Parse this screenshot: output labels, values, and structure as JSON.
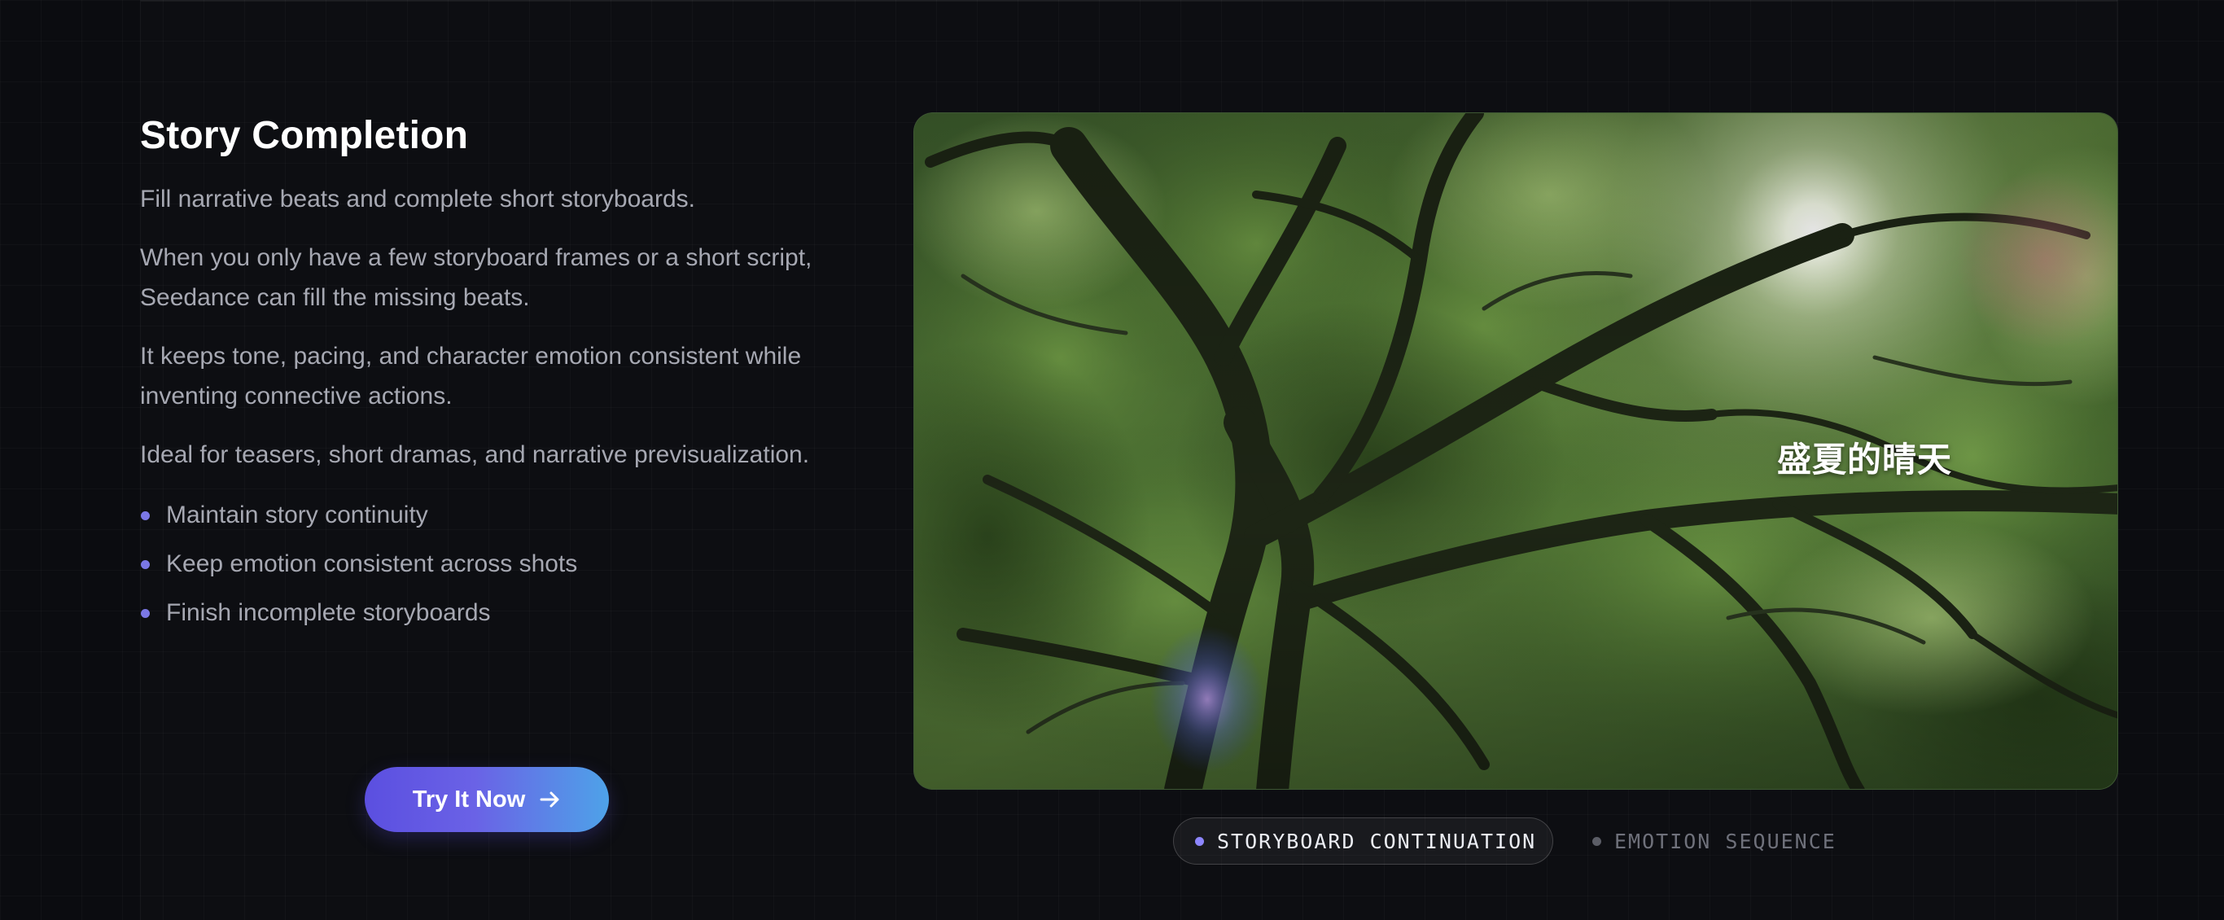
{
  "section": {
    "title": "Story Completion",
    "paragraphs": [
      "Fill narrative beats and complete short storyboards.",
      "When you only have a few storyboard frames or a short script, Seedance can fill the missing beats.",
      "It keeps tone, pacing, and character emotion consistent while inventing connective actions.",
      "Ideal for teasers, short dramas, and narrative previsualization."
    ],
    "bullets": [
      "Maintain story continuity",
      "Keep emotion consistent across shots",
      "Finish incomplete storyboards"
    ],
    "cta": {
      "label": "Try It Now",
      "icon": "arrow-right-icon"
    }
  },
  "media": {
    "caption": "盛夏的晴天"
  },
  "tabs": [
    {
      "label": "STORYBOARD CONTINUATION",
      "active": true
    },
    {
      "label": "EMOTION SEQUENCE",
      "active": false
    }
  ],
  "colors": {
    "background": "#0b0c10",
    "accent": "#7b78e6",
    "cta_gradient_start": "#5b4fe0",
    "cta_gradient_end": "#4ea2e8",
    "text_primary": "#ffffff",
    "text_secondary": "#a6a8b2"
  }
}
